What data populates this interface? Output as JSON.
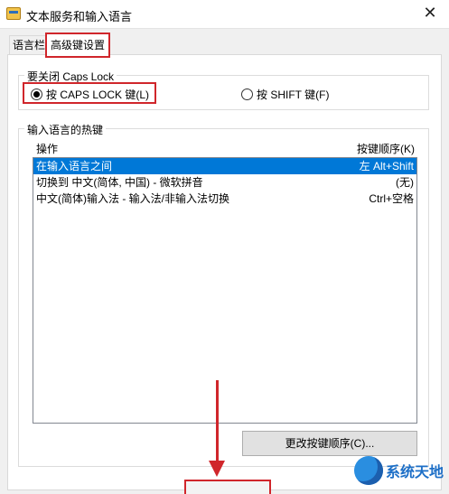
{
  "window": {
    "title": "文本服务和输入语言",
    "icon": "keyboard-app-icon",
    "close_glyph": "✕"
  },
  "tabs": [
    {
      "label": "语言栏",
      "selected": false
    },
    {
      "label": "高级键设置",
      "selected": true
    }
  ],
  "caps_group": {
    "title": "要关闭 Caps Lock",
    "options": [
      {
        "label": "按 CAPS LOCK 键(L)",
        "checked": true
      },
      {
        "label": "按 SHIFT 键(F)",
        "checked": false
      }
    ]
  },
  "hotkey_group": {
    "title": "输入语言的热键",
    "columns": {
      "action": "操作",
      "keys": "按键顺序(K)"
    },
    "rows": [
      {
        "action": "在输入语言之间",
        "keys": "左 Alt+Shift",
        "selected": true
      },
      {
        "action": "切换到 中文(简体, 中国) - 微软拼音",
        "keys": "(无)",
        "selected": false
      },
      {
        "action": "中文(简体)输入法 - 输入法/非输入法切换",
        "keys": "Ctrl+空格",
        "selected": false
      }
    ],
    "change_button": "更改按键顺序(C)..."
  },
  "annotation": {
    "highlight_color": "#d0262b"
  },
  "watermark": {
    "text": "系统天地"
  },
  "colors": {
    "selection": "#0078d7",
    "annotation": "#d0262b"
  }
}
